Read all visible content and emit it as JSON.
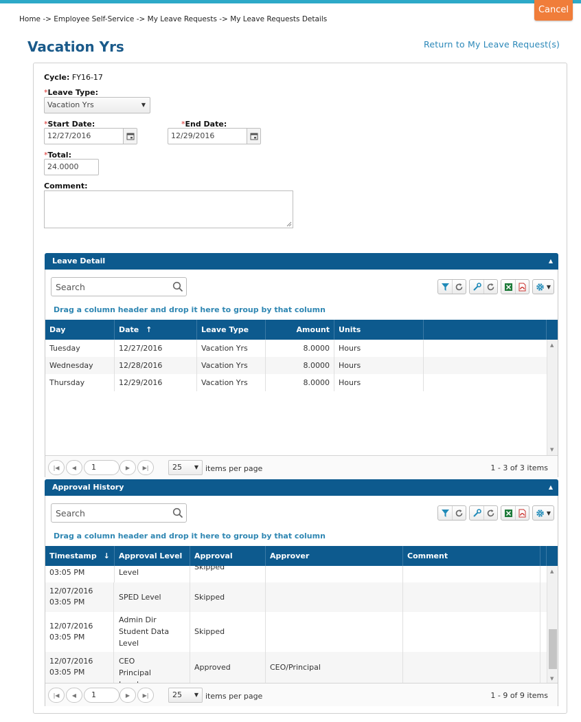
{
  "header": {
    "cancel_label": "Cancel",
    "breadcrumb": "Home -> Employee Self-Service -> My Leave Requests -> My Leave Requests Details",
    "title": "Vacation Yrs",
    "return_link": "Return to My Leave Request(s)"
  },
  "colors": {
    "accent_bar": "#2da9c8",
    "cancel": "#f07d3a",
    "header_blue": "#0d5a8e",
    "title": "#1a5a8a",
    "link": "#2a87b8"
  },
  "form": {
    "cycle_label": "Cycle",
    "cycle_value": "FY16-17",
    "required_mark": "*",
    "leave_type_label": "Leave Type",
    "leave_type_value": "Vacation Yrs",
    "start_date_label": "Start Date",
    "start_date_value": "12/27/2016",
    "end_date_label": "End Date",
    "end_date_value": "12/29/2016",
    "total_label": "Total",
    "total_value": "24.0000",
    "comment_label": "Comment",
    "comment_value": ""
  },
  "leave_detail": {
    "title": "Leave Detail",
    "search_placeholder": "Search",
    "group_hint": "Drag a column header and drop it here to group by that column",
    "columns": [
      "Day",
      "Date",
      "Leave Type",
      "Amount",
      "Units"
    ],
    "sort_indicator": "↑",
    "rows": [
      {
        "day": "Tuesday",
        "date": "12/27/2016",
        "leave_type": "Vacation Yrs",
        "amount": "8.0000",
        "units": "Hours"
      },
      {
        "day": "Wednesday",
        "date": "12/28/2016",
        "leave_type": "Vacation Yrs",
        "amount": "8.0000",
        "units": "Hours"
      },
      {
        "day": "Thursday",
        "date": "12/29/2016",
        "leave_type": "Vacation Yrs",
        "amount": "8.0000",
        "units": "Hours"
      }
    ],
    "pager": {
      "page": "1",
      "page_size": "25",
      "items_per_page": "items per page",
      "info": "1 - 3 of 3 items"
    }
  },
  "approval_history": {
    "title": "Approval History",
    "search_placeholder": "Search",
    "group_hint": "Drag a column header and drop it here to group by that column",
    "columns": [
      "Timestamp",
      "Approval Level",
      "Approval",
      "Approver",
      "Comment"
    ],
    "sort_indicator": "↓",
    "rows": [
      {
        "timestamp": "03:05 PM",
        "level": "Level",
        "approval": "Skipped",
        "approver": "",
        "comment": ""
      },
      {
        "timestamp": "12/07/2016 03:05 PM",
        "level": "SPED Level",
        "approval": "Skipped",
        "approver": "",
        "comment": ""
      },
      {
        "timestamp": "12/07/2016 03:05 PM",
        "level": "Admin Dir Student Data Level",
        "approval": "Skipped",
        "approver": "",
        "comment": ""
      },
      {
        "timestamp": "12/07/2016 03:05 PM",
        "level": "CEO Principal Level",
        "approval": "Approved",
        "approver": "CEO/Principal",
        "comment": ""
      }
    ],
    "pager": {
      "page": "1",
      "page_size": "25",
      "items_per_page": "items per page",
      "info": "1 - 9 of 9 items"
    }
  },
  "icons": {
    "search": "search-icon",
    "calendar": "calendar-icon",
    "filter": "filter-icon",
    "refresh": "refresh-icon",
    "wrench": "wrench-icon",
    "excel": "excel-icon",
    "pdf": "pdf-icon",
    "gear": "gear-icon",
    "collapse": "chevron-up-icon"
  }
}
